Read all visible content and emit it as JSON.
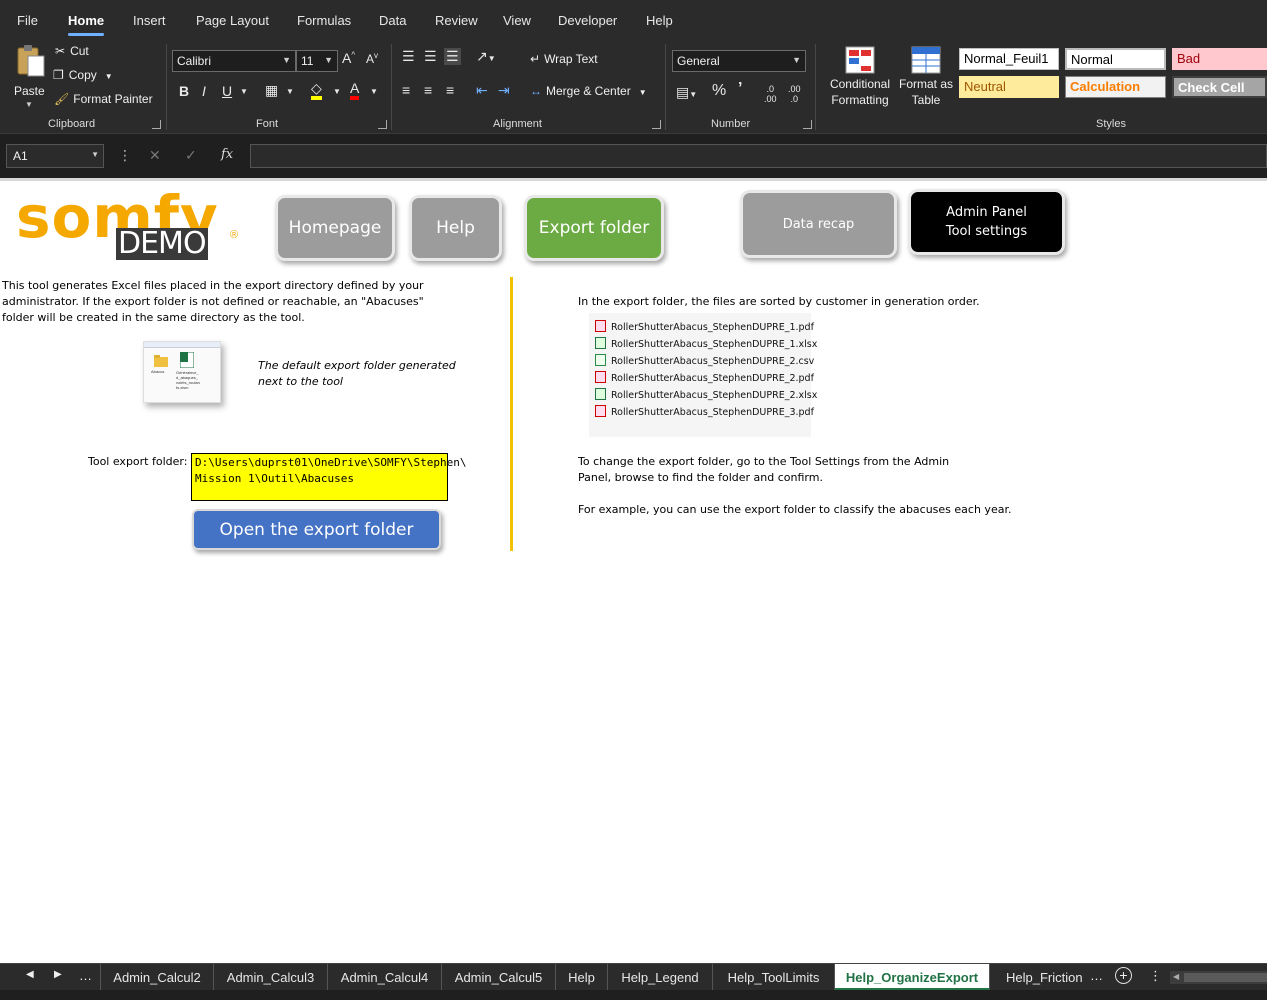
{
  "menu": {
    "tabs": [
      "File",
      "Home",
      "Insert",
      "Page Layout",
      "Formulas",
      "Data",
      "Review",
      "View",
      "Developer",
      "Help"
    ],
    "active": "Home"
  },
  "ribbon": {
    "clipboard": {
      "paste": "Paste",
      "cut": "Cut",
      "copy": "Copy",
      "format_painter": "Format Painter",
      "label": "Clipboard"
    },
    "font": {
      "name": "Calibri",
      "size": "11",
      "label": "Font"
    },
    "alignment": {
      "wrap_text": "Wrap Text",
      "merge_center": "Merge & Center",
      "label": "Alignment"
    },
    "number": {
      "format": "General",
      "label": "Number"
    },
    "styles": {
      "conditional_formatting": "Conditional Formatting",
      "format_as_table": "Format as Table",
      "cells": [
        "Normal_Feuil1",
        "Normal",
        "Bad",
        "Neutral",
        "Calculation",
        "Check Cell"
      ],
      "label": "Styles"
    }
  },
  "formula_bar": {
    "name_box": "A1",
    "formula": ""
  },
  "sheet": {
    "logo_text": "somfy",
    "logo_sub": "DEMO",
    "buttons": {
      "homepage": "Homepage",
      "help": "Help",
      "export_folder": "Export folder",
      "data_recap": "Data recap",
      "admin_line1": "Admin Panel",
      "admin_line2": "Tool settings"
    },
    "intro_text": "This tool generates Excel files placed in the export directory defined by your administrator. If the export folder is not defined or reachable, an \"Abacuses\" folder will be created in the same directory as the tool.",
    "default_folder_caption_1": "The default export folder generated",
    "default_folder_caption_2": "next to the tool",
    "thumb_folder_label": "Abacus",
    "thumb_file_label": "Générateur_d_abaques_volets_roulants.xlsm",
    "export_folder_label": "Tool export folder:",
    "export_folder_path_1": "D:\\Users\\duprst01\\OneDrive\\SOMFY\\Stephen\\",
    "export_folder_path_2": "Mission 1\\Outil\\Abacuses",
    "open_button": "Open the export folder",
    "right_intro": "In the export folder, the files are sorted by customer in generation order.",
    "files": [
      "RollerShutterAbacus_StephenDUPRE_1.pdf",
      "RollerShutterAbacus_StephenDUPRE_1.xlsx",
      "RollerShutterAbacus_StephenDUPRE_2.csv",
      "RollerShutterAbacus_StephenDUPRE_2.pdf",
      "RollerShutterAbacus_StephenDUPRE_2.xlsx",
      "RollerShutterAbacus_StephenDUPRE_3.pdf"
    ],
    "change_text_1": "To change the export folder, go to the Tool Settings from the Admin",
    "change_text_2": "Panel, browse to find the folder and confirm.",
    "example_text": "For example, you can use the export folder to classify the abacuses each year."
  },
  "sheet_tabs": [
    "Admin_Calcul2",
    "Admin_Calcul3",
    "Admin_Calcul4",
    "Admin_Calcul5",
    "Help",
    "Help_Legend",
    "Help_ToolLimits",
    "Help_OrganizeExport",
    "Help_Friction"
  ],
  "active_sheet": "Help_OrganizeExport",
  "colors": {
    "somfy_orange": "#f5a800",
    "button_green": "#6cab43",
    "button_grey": "#9c9c9c",
    "button_blue": "#4472c4",
    "divider_yellow": "#f2c200"
  }
}
